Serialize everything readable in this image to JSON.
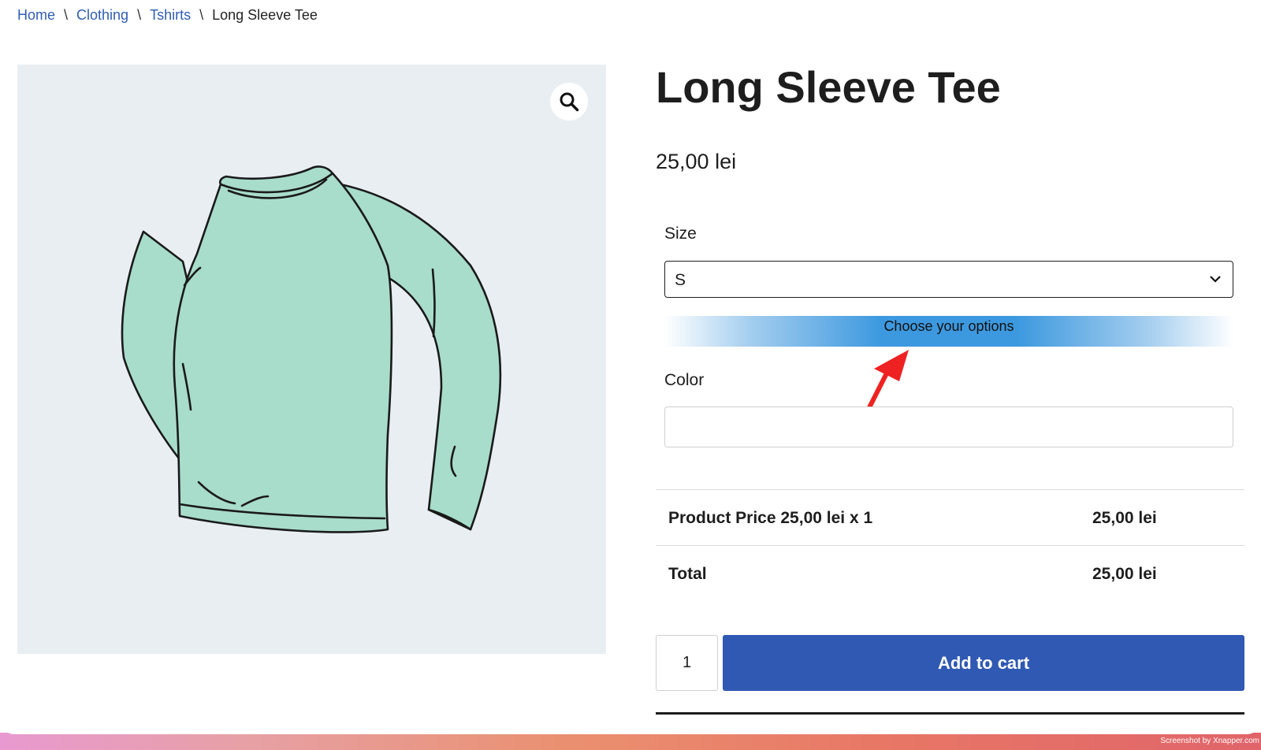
{
  "breadcrumb": {
    "home": "Home",
    "clothing": "Clothing",
    "tshirts": "Tshirts",
    "current": "Long Sleeve Tee",
    "separator": "\\"
  },
  "product": {
    "title": "Long Sleeve Tee",
    "price": "25,00 lei",
    "image_icon": "long-sleeve-tee-illustration",
    "zoom_icon": "magnifier-icon"
  },
  "options": {
    "size_label": "Size",
    "size_value": "S",
    "banner_text": "Choose your options",
    "color_label": "Color",
    "color_value": ""
  },
  "summary": {
    "product_price_label": "Product Price 25,00 lei x 1",
    "product_price_value": "25,00 lei",
    "total_label": "Total",
    "total_value": "25,00 lei"
  },
  "cart": {
    "quantity": "1",
    "add_to_cart_label": "Add to cart"
  },
  "watermark": "Screenshot by Xnapper.com",
  "colors": {
    "accent": "#2f59b2",
    "link": "#2f5db3",
    "banner": "#3d99df",
    "annotation_arrow": "#ee2222",
    "shirt": "#a8dccb"
  }
}
